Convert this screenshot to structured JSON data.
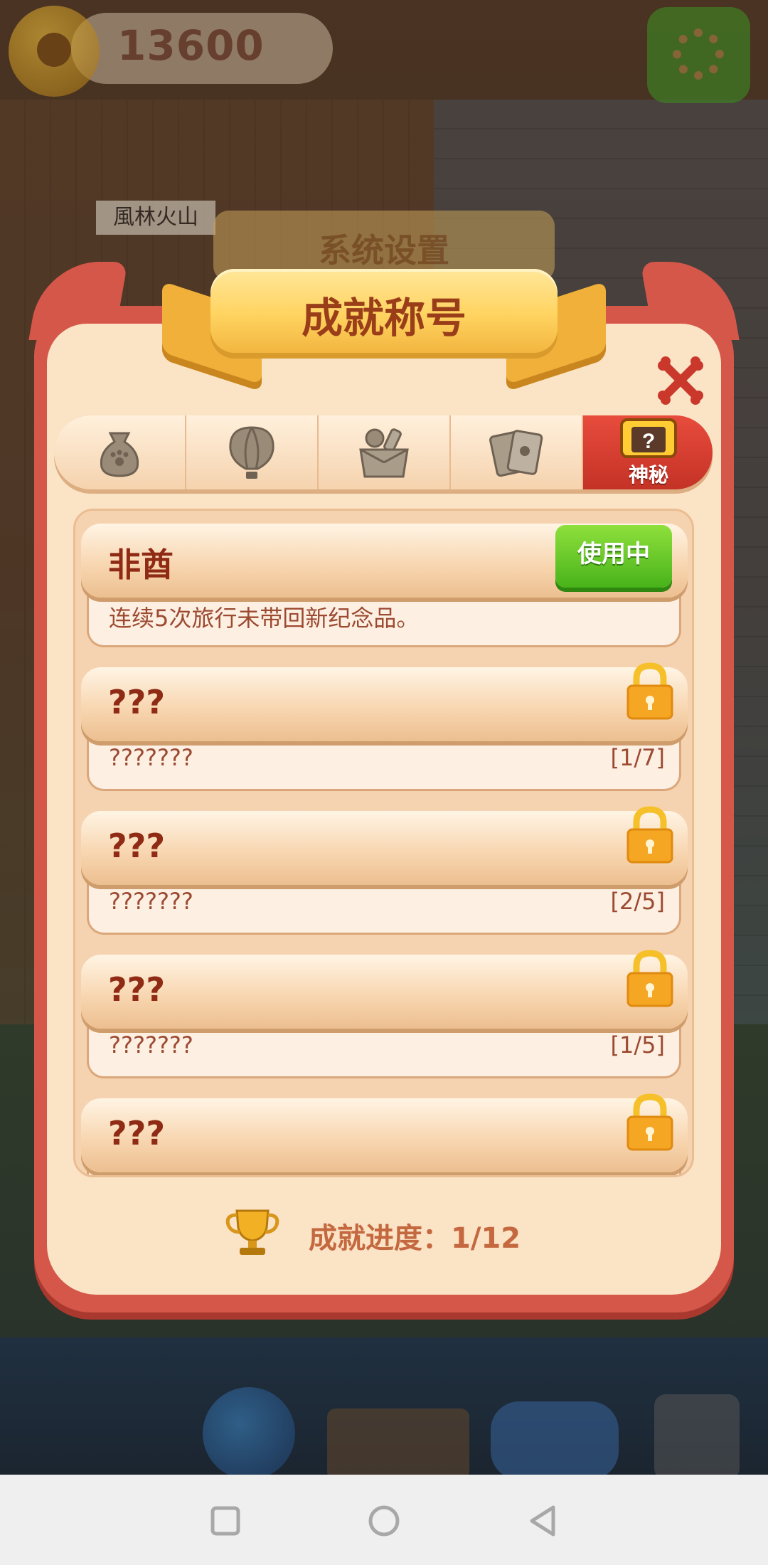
{
  "hud": {
    "coins": "13600",
    "settings_icon": "gear-icon",
    "coin_icon": "paw-coin-icon"
  },
  "background": {
    "sign_text": "風林火山"
  },
  "dialog": {
    "ghost_title": "系统设置",
    "title": "成就称号",
    "close_icon": "crossed-bones-close-icon",
    "tabs": [
      {
        "icon": "pouch-icon",
        "label": ""
      },
      {
        "icon": "hot-air-balloon-icon",
        "label": ""
      },
      {
        "icon": "souvenir-box-icon",
        "label": ""
      },
      {
        "icon": "cards-icon",
        "label": ""
      },
      {
        "icon": "mystery-chest-icon",
        "label": "神秘",
        "active": true
      }
    ],
    "achievements": [
      {
        "title": "非酋",
        "description": "连续5次旅行未带回新纪念品。",
        "status": "使用中",
        "locked": false
      },
      {
        "title": "???",
        "description": "???????",
        "progress": "[1/7]",
        "locked": true
      },
      {
        "title": "???",
        "description": "???????",
        "progress": "[2/5]",
        "locked": true
      },
      {
        "title": "???",
        "description": "???????",
        "progress": "[1/5]",
        "locked": true
      },
      {
        "title": "???",
        "locked": true
      }
    ],
    "footer": {
      "trophy_icon": "trophy-icon",
      "progress_text": "成就进度：1/12"
    }
  },
  "navbar": {
    "recent": "square-icon",
    "home": "circle-icon",
    "back": "triangle-back-icon"
  },
  "colors": {
    "panel": "#fbe3c6",
    "frame": "#d5574a",
    "active_tab": "#e84c3d",
    "in_use_green": "#48b31a",
    "lock_gold": "#f5a623",
    "title_text": "#9a3e1a"
  }
}
